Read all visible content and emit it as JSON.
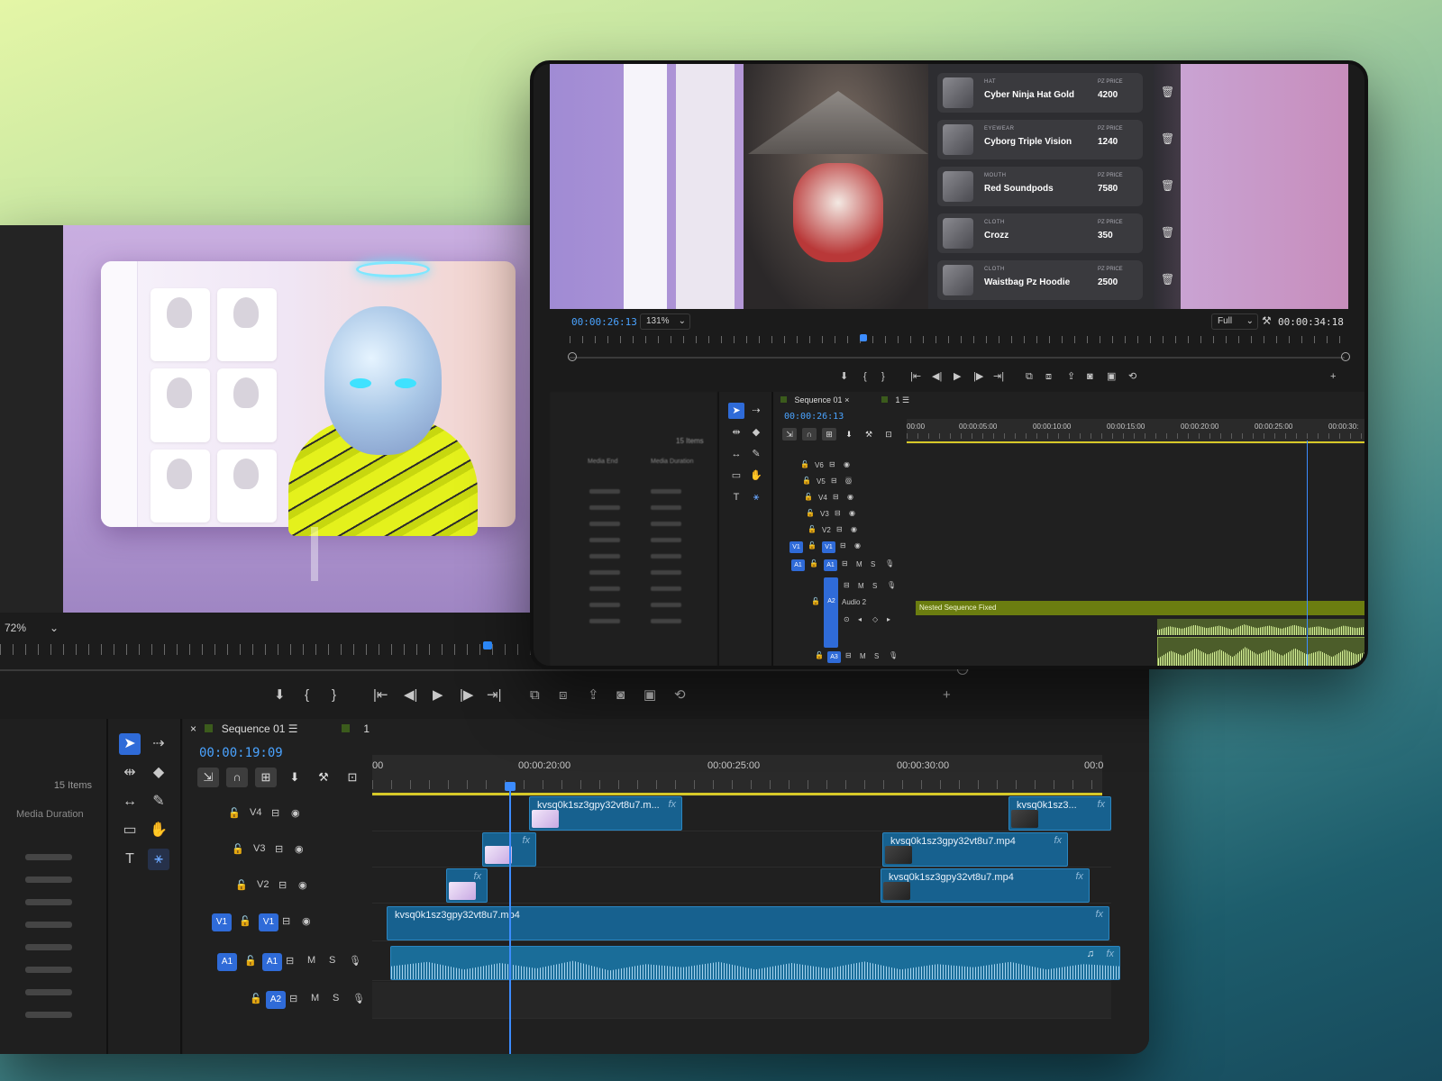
{
  "back": {
    "zoom": "72%",
    "items_count": "15 Items",
    "media_duration_header": "Media Duration",
    "sequence_tab": "Sequence 01",
    "sequence_number": "1",
    "timecode": "00:00:19:09",
    "ruler_labels": [
      "00",
      "00:00:20:00",
      "00:00:25:00",
      "00:00:30:00",
      "00:0"
    ],
    "tracks": {
      "v4": "V4",
      "v3": "V3",
      "v2": "V2",
      "v1": "V1",
      "a1": "A1",
      "a2": "A2",
      "mute": "M",
      "solo": "S"
    },
    "clips": {
      "v4_a": "kvsq0k1sz3gpy32vt8u7.m...",
      "v4_b": "kvsq0k1sz3...",
      "v3_b": "kvsq0k1sz3gpy32vt8u7.mp4",
      "v2_b": "kvsq0k1sz3gpy32vt8u7.mp4",
      "v1": "kvsq0k1sz3gpy32vt8u7.mp4",
      "fx": "fx"
    }
  },
  "front": {
    "timecode_left": "00:00:26:13",
    "zoom": "131%",
    "resolution": "Full",
    "timecode_right": "00:00:34:18",
    "items_count": "15 Items",
    "media_end_header": "Media End",
    "media_duration_header": "Media Duration",
    "sequence_tab": "Sequence 01",
    "sequence_number": "1",
    "timeline_timecode": "00:00:26:13",
    "ruler_labels": [
      "00:00",
      "00:00:05:00",
      "00:00:10:00",
      "00:00:15:00",
      "00:00:20:00",
      "00:00:25:00",
      "00:00:30:"
    ],
    "tracks": {
      "v6": "V6",
      "v5": "V5",
      "v4": "V4",
      "v3": "V3",
      "v2": "V2",
      "v1": "V1",
      "a1": "A1",
      "a2": "A2",
      "a3": "A3",
      "audio2": "Audio 2",
      "mute": "M",
      "solo": "S"
    },
    "nested_clip": "Nested Sequence Fixed",
    "shop_items": [
      {
        "category": "HAT",
        "name": "Cyber Ninja Hat Gold",
        "price_label": "PZ PRICE",
        "price": "4200"
      },
      {
        "category": "EYEWEAR",
        "name": "Cyborg Triple Vision",
        "price_label": "PZ PRICE",
        "price": "1240"
      },
      {
        "category": "MOUTH",
        "name": "Red Soundpods",
        "price_label": "PZ PRICE",
        "price": "7580"
      },
      {
        "category": "CLOTH",
        "name": "Crozz",
        "price_label": "PZ PRICE",
        "price": "350"
      },
      {
        "category": "CLOTH",
        "name": "Waistbag Pz Hoodie",
        "price_label": "PZ PRICE",
        "price": "2500"
      }
    ]
  },
  "colors": {
    "accent_blue": "#2f6bd8",
    "timecode_blue": "#4aa3ff",
    "clip_blue": "#17618f",
    "nested_green": "#6b7d10"
  }
}
